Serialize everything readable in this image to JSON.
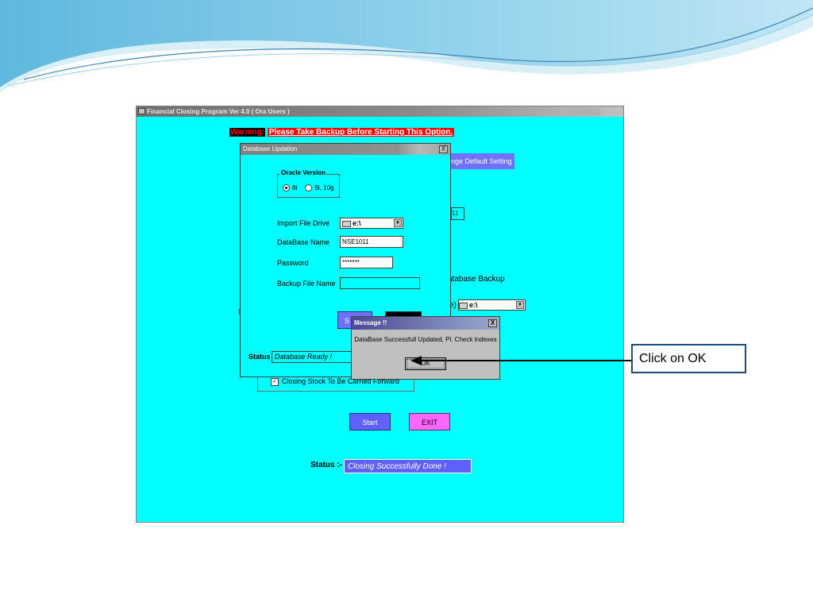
{
  "app": {
    "title": "Financial Closing Program Ver 4.0 ( Ora Users )",
    "warning_label": "Warning:",
    "warning_text": "Please Take Backup Before Starting This Option.",
    "change_default_label": "ange Default Setting",
    "partial_field_text": "11",
    "database_backup_label": "atabase Backup",
    "drive_label": "e)",
    "drive_value": "e:\\",
    "paren_glyph": "(",
    "closing_stock_label": "Closing Stock To Be Carried Forward",
    "closing_stock_checked": true,
    "start_label": "Start",
    "exit_label": "EXIT",
    "status_label": "Status :-",
    "status_value": "Closing Successfully Done !"
  },
  "db_dialog": {
    "title": "Database Updation",
    "close_glyph": "X",
    "oracle_group_label": "Oracle Version",
    "oracle_options": [
      "8i",
      "9i, 10g"
    ],
    "oracle_selected": "8i",
    "import_drive_label": "Import File Drive",
    "import_drive_value": "e:\\",
    "database_name_label": "DataBase Name",
    "database_name_value": "NSE1011",
    "password_label": "Password",
    "password_value": "*******",
    "backup_file_label": "Backup File Name",
    "backup_file_value": "",
    "button1_label": "S",
    "status_label": "Status",
    "status_value": "Database Ready !"
  },
  "message_dialog": {
    "title": "Message !!",
    "close_glyph": "X",
    "text": "DataBase Successfull Updated, Pl. Check Indexes",
    "ok_label": "OK"
  },
  "callout": {
    "text": "Click on OK",
    "color": "#1f4e79"
  },
  "colors": {
    "window_bg": "#00ffff",
    "start_btn": "#6060ff",
    "exit_btn": "#ff66ff",
    "warning": "#ff0000"
  }
}
